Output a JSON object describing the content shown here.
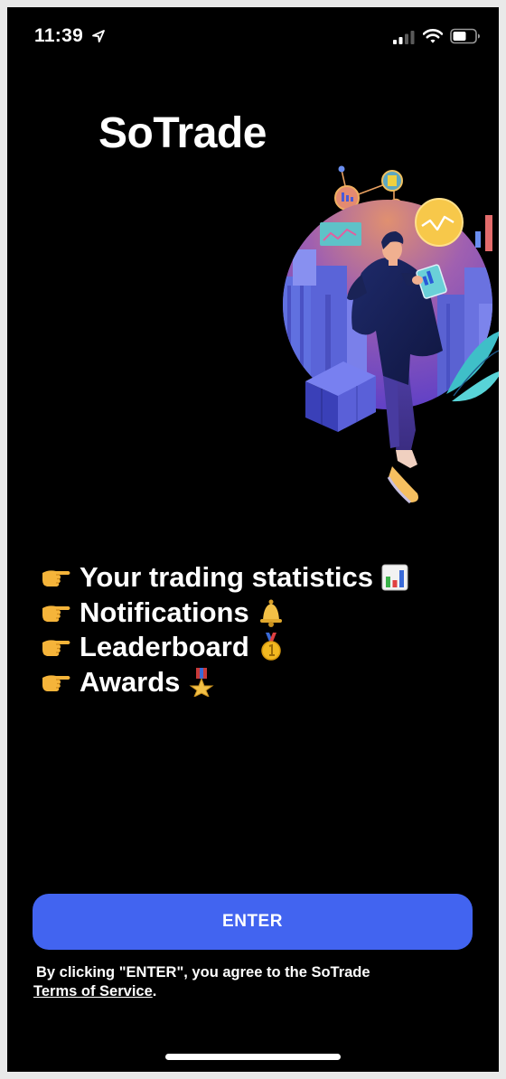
{
  "status_bar": {
    "time": "11:39",
    "icons": [
      "location-arrow-icon",
      "cellular-signal-icon",
      "wifi-icon",
      "battery-icon"
    ]
  },
  "app": {
    "title": "SoTrade"
  },
  "hero": {
    "illustration": "man-with-tablet-trading-illustration"
  },
  "features": [
    {
      "label": "Your trading statistics",
      "lead_icon": "pointing-hand-icon",
      "trail_icon": "bar-chart-icon"
    },
    {
      "label": "Notifications",
      "lead_icon": "pointing-hand-icon",
      "trail_icon": "bell-icon"
    },
    {
      "label": "Leaderboard",
      "lead_icon": "pointing-hand-icon",
      "trail_icon": "first-place-medal-icon"
    },
    {
      "label": "Awards",
      "lead_icon": "pointing-hand-icon",
      "trail_icon": "military-medal-icon"
    }
  ],
  "enter_button": {
    "label": "ENTER"
  },
  "consent": {
    "prefix": "By clicking \"ENTER\", you agree to the SoTrade",
    "link": "Terms of Service",
    "suffix": "."
  },
  "colors": {
    "background": "#000000",
    "accent": "#4264f0",
    "text": "#ffffff"
  }
}
